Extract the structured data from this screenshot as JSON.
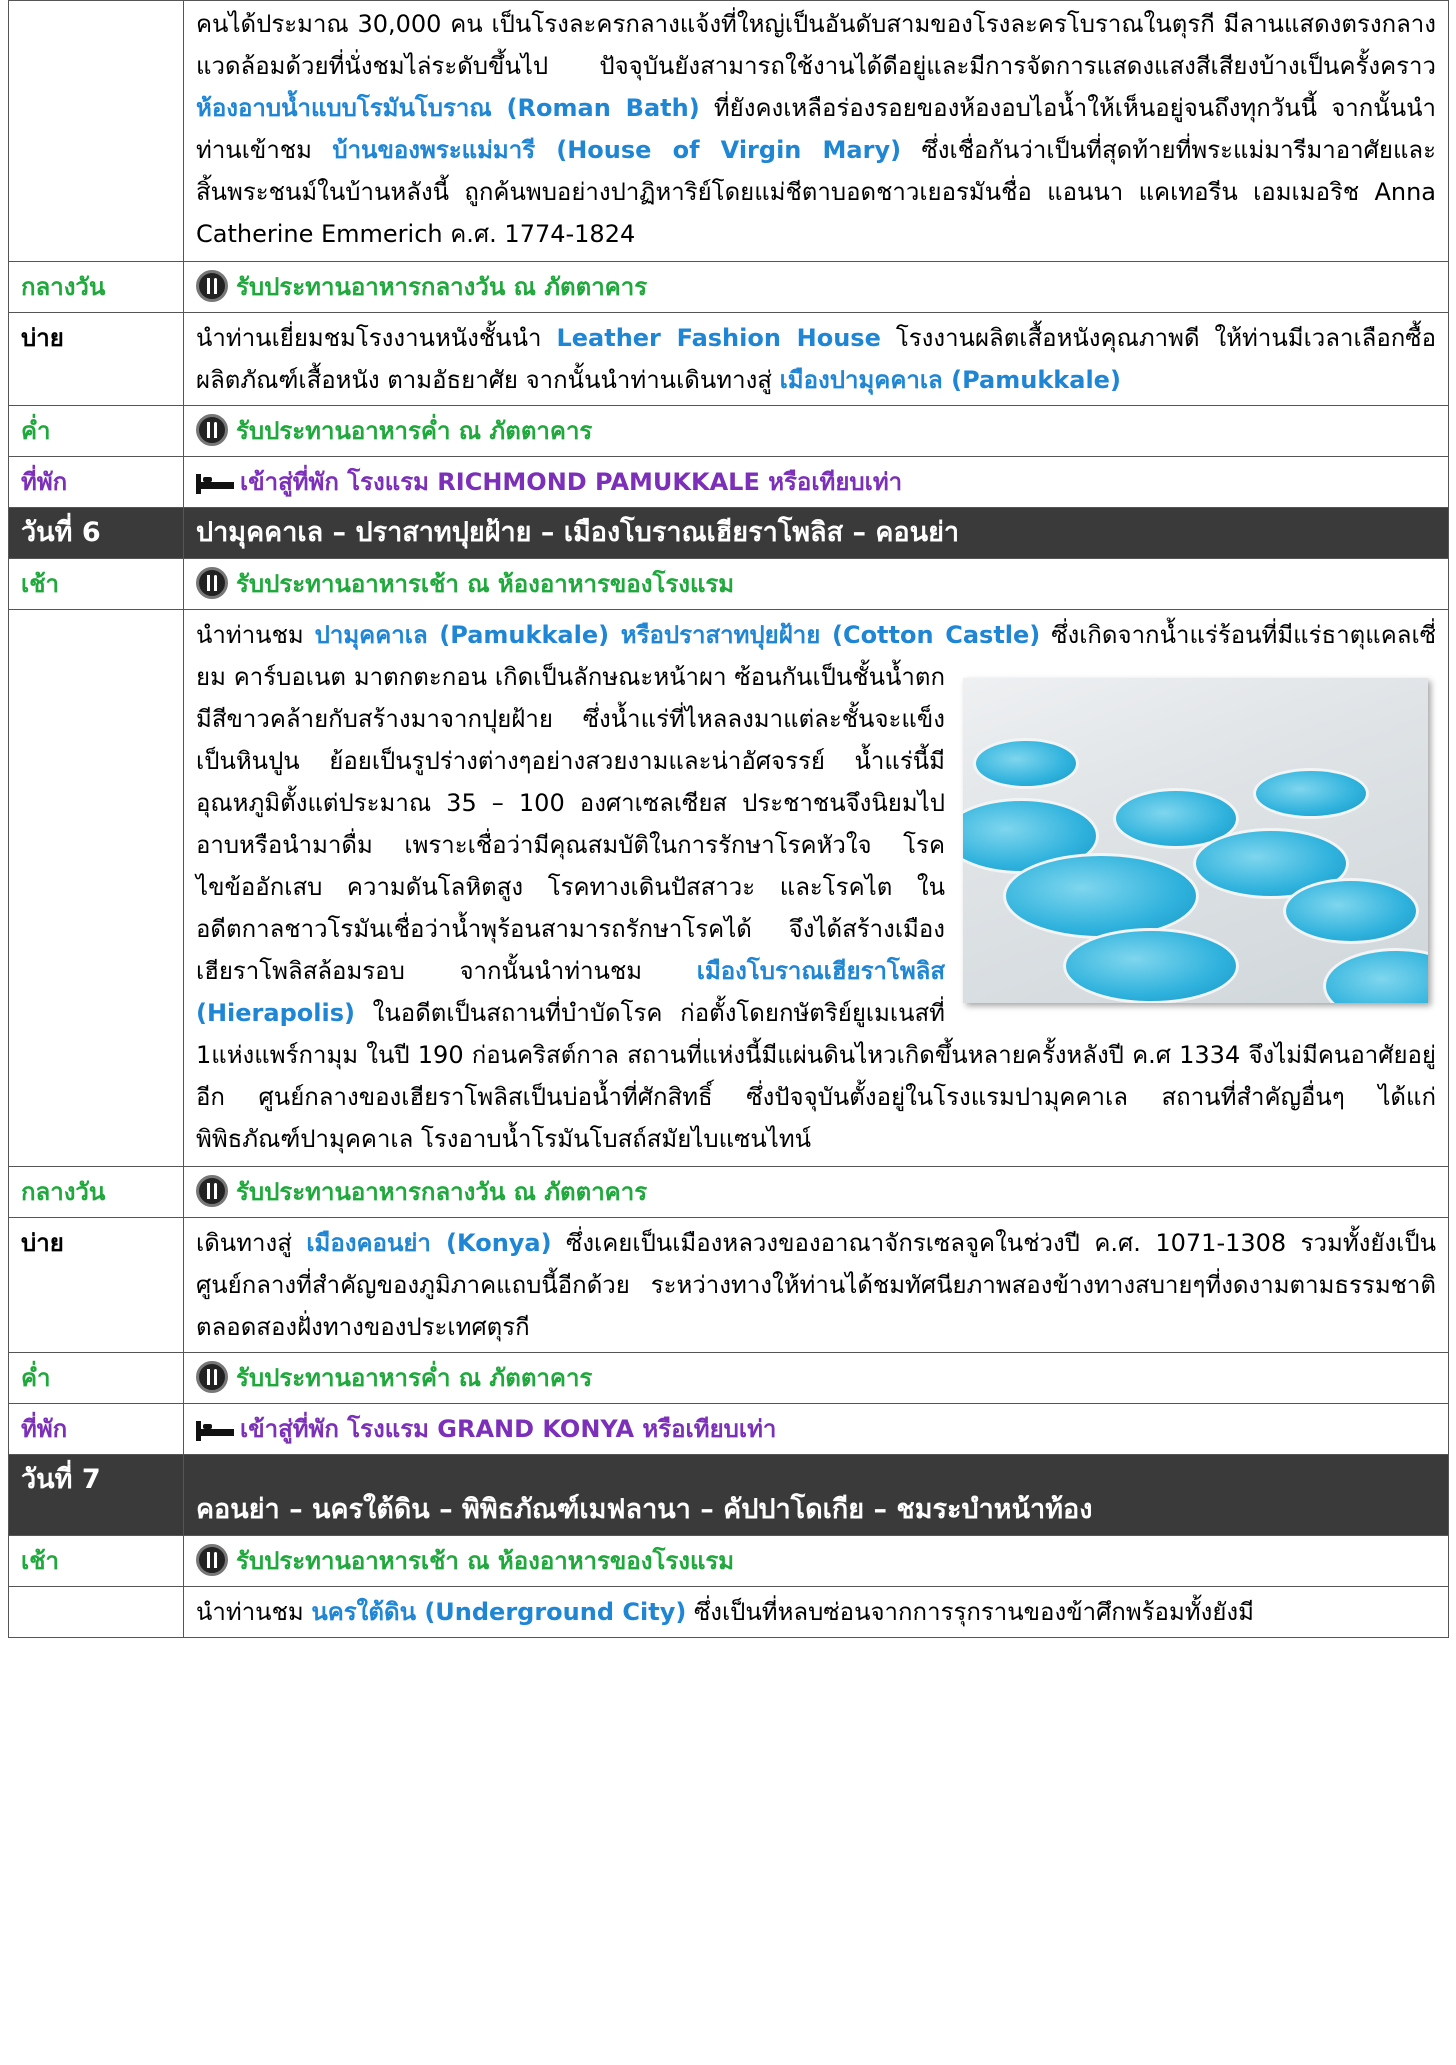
{
  "intro": {
    "text1": "คนได้ประมาณ 30,000 คน เป็นโรงละครกลางแจ้งที่ใหญ่เป็นอันดับสามของโรงละครโบราณในตุรกี มีลานแสดงตรงกลางแวดล้อมด้วยที่นั่งชมไล่ระดับขึ้นไป ปัจจุบันยังสามารถใช้งานได้ดีอยู่และมีการจัดการแสดงแสงสีเสียงบ้างเป็นครั้งคราว ",
    "hl1": "ห้องอาบน้ำแบบโรมันโบราณ (Roman Bath)",
    "text2": " ที่ยังคงเหลือร่องรอยของห้องอบไอน้ำให้เห็นอยู่จนถึงทุกวันนี้ จากนั้นนำท่านเข้าชม ",
    "hl2": "บ้านของพระแม่มารี (House of Virgin Mary)",
    "text3": " ซึ่งเชื่อกันว่าเป็นที่สุดท้ายที่พระแม่มารีมาอาศัยและสิ้นพระชนม์ในบ้านหลังนี้ ถูกค้นพบอย่างปาฏิหาริย์โดยแม่ชีตาบอดชาวเยอรมันชื่อ แอนนา แคเทอรีน เอมเมอริช Anna Catherine Emmerich ค.ศ. 1774-1824"
  },
  "rows": {
    "lunch1": {
      "label": "กลางวัน",
      "text": "รับประทานอาหารกลางวัน ณ ภัตตาคาร"
    },
    "afternoon1": {
      "label": "บ่าย",
      "t1": "นำท่านเยี่ยมชมโรงงานหนังชั้นนำ ",
      "h1": "Leather Fashion House",
      "t2": " โรงงานผลิตเสื้อหนังคุณภาพดี ให้ท่านมีเวลาเลือกซื้อ ผลิตภัณฑ์เสื้อหนัง ตามอัธยาศัย จากนั้นนำท่านเดินทางสู่ ",
      "h2": "เมืองปามุคคาเล (Pamukkale)"
    },
    "dinner1": {
      "label": "ค่ำ",
      "text": "รับประทานอาหารค่ำ ณ ภัตตาคาร"
    },
    "hotel1": {
      "label": "ที่พัก",
      "text": "เข้าสู่ที่พัก โรงแรม RICHMOND PAMUKKALE หรือเทียบเท่า"
    },
    "day6": {
      "label": "วันที่ 6",
      "title": "ปามุคคาเล – ปราสาทปุยฝ้าย – เมืองโบราณเฮียราโพลิส – คอนย่า"
    },
    "breakfast6": {
      "label": "เช้า",
      "text": "รับประทานอาหารเช้า ณ ห้องอาหารของโรงแรม"
    },
    "morning6": {
      "t1": "นำท่านชม ",
      "h1": "ปามุคคาเล (Pamukkale) หรือปราสาทปุยฝ้าย (Cotton Castle)",
      "t2": " ซึ่งเกิดจากน้ำแร่ร้อนที่มีแร่ธาตุแคลเซี่ยม คาร์บอเนต มาตกตะกอน เกิดเป็นลักษณะหน้าผา ซ้อนกันเป็นชั้นน้ำตก มีสีขาวคล้ายกับสร้างมาจากปุยฝ้าย ซึ่งน้ำแร่ที่ไหลลงมาแต่ละชั้นจะแข็งเป็นหินปูน ย้อยเป็นรูปร่างต่างๆอย่างสวยงามและน่าอัศจรรย์ น้ำแร่นี้มีอุณหภูมิตั้งแต่ประมาณ 35 – 100 องศาเซลเซียส ประชาชนจึงนิยมไปอาบหรือนำมาดื่ม เพราะเชื่อว่ามีคุณสมบัติในการรักษาโรคหัวใจ โรคไขข้ออักเสบ ความดันโลหิตสูง โรคทางเดินปัสสาวะ และโรคไต ในอดีตกาลชาวโรมันเชื่อว่าน้ำพุร้อนสามารถรักษาโรคได้ จึงได้สร้างเมืองเฮียราโพลิสล้อมรอบ จากนั้นนำท่านชม ",
      "h2": "เมืองโบราณเฮียราโพลิส (Hierapolis)",
      "t3": " ในอดีตเป็นสถานที่บำบัดโรค ก่อตั้งโดยกษัตริย์ยูเมเนสที่ 1แห่งแพร์กามุม ในปี 190 ก่อนคริสต์กาล สถานที่แห่งนี้มีแผ่นดินไหวเกิดขึ้นหลายครั้งหลังปี ค.ศ 1334 จึงไม่มีคนอาศัยอยู่อีก ศูนย์กลางของเฮียราโพลิสเป็นบ่อน้ำที่ศักสิทธิ์ ซึ่งปัจจุบันตั้งอยู่ในโรงแรมปามุคคาเล สถานที่สำคัญอื่นๆ ได้แก่ พิพิธภัณฑ์ปามุคคาเล โรงอาบน้ำโรมันโบสถ์สมัยไบแซนไทน์"
    },
    "lunch6": {
      "label": "กลางวัน",
      "text": "รับประทานอาหารกลางวัน ณ ภัตตาคาร"
    },
    "afternoon6": {
      "label": "บ่าย",
      "t1": "เดินทางสู่ ",
      "h1": "เมืองคอนย่า (Konya)",
      "t2": " ซึ่งเคยเป็นเมืองหลวงของอาณาจักรเซลจูคในช่วงปี ค.ศ. 1071-1308 รวมทั้งยังเป็นศูนย์กลางที่สำคัญของภูมิภาคแถบนี้อีกด้วย ระหว่างทางให้ท่านได้ชมทัศนียภาพสองข้างทางสบายๆที่งดงามตามธรรมชาติตลอดสองฝั่งทางของประเทศตุรกี"
    },
    "dinner6": {
      "label": "ค่ำ",
      "text": "รับประทานอาหารค่ำ ณ ภัตตาคาร"
    },
    "hotel6": {
      "label": "ที่พัก",
      "text": "เข้าสู่ที่พัก โรงแรม GRAND KONYA หรือเทียบเท่า"
    },
    "day7": {
      "label": "วันที่ 7",
      "title": "คอนย่า – นครใต้ดิน – พิพิธภัณฑ์เมฟลานา – คัปปาโดเกีย – ชมระบำหน้าท้อง"
    },
    "breakfast7": {
      "label": "เช้า",
      "text": "รับประทานอาหารเช้า ณ ห้องอาหารของโรงแรม"
    },
    "morning7": {
      "t1": "นำท่านชม ",
      "h1": "นครใต้ดิน (Underground City)",
      "t2": " ซึ่งเป็นที่หลบซ่อนจากการรุกรานของข้าศึกพร้อมทั้งยังมี"
    }
  },
  "icons": {
    "meal": "meal-plate-icon",
    "hotel": "bed-icon"
  },
  "colors": {
    "highlight": "#1e86d4",
    "meal": "#1fa83c",
    "hotel": "#7c2fb8",
    "day_header_bg": "#3a3a3a"
  }
}
